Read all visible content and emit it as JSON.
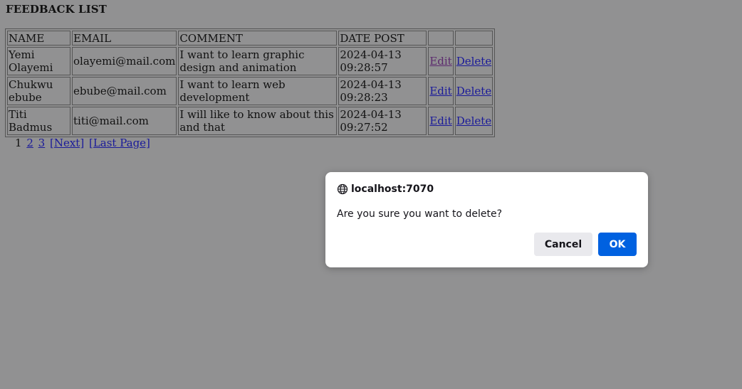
{
  "page": {
    "heading": "FEEDBACK LIST"
  },
  "table": {
    "headers": [
      "NAME",
      "EMAIL",
      "COMMENT",
      "DATE POST",
      "",
      ""
    ],
    "rows": [
      {
        "name": "Yemi Olayemi",
        "email": "olayemi@mail.com",
        "comment": "I want to learn graphic design and animation",
        "date": "2024-04-13 09:28:57",
        "edit": "Edit",
        "delete": "Delete"
      },
      {
        "name": "Chukwu ebube",
        "email": "ebube@mail.com",
        "comment": "I want to learn web development",
        "date": "2024-04-13 09:28:23",
        "edit": "Edit",
        "delete": "Delete"
      },
      {
        "name": "Titi Badmus",
        "email": "titi@mail.com",
        "comment": "I will like to know about this and that",
        "date": "2024-04-13 09:27:52",
        "edit": "Edit",
        "delete": "Delete"
      }
    ]
  },
  "pager": {
    "current": "1",
    "page2": "2",
    "page3": "3",
    "next": "[Next]",
    "last": "[Last Page]"
  },
  "dialog": {
    "origin": "localhost:7070",
    "icon": "globe-icon",
    "message": "Are you sure you want to delete?",
    "cancel_label": "Cancel",
    "ok_label": "OK"
  },
  "colors": {
    "overlay_background": "#919192",
    "link": "#1a1a9a",
    "visited_link": "#5c2a6e",
    "ok_button": "#0061e0",
    "cancel_button": "#e9e9ed"
  }
}
